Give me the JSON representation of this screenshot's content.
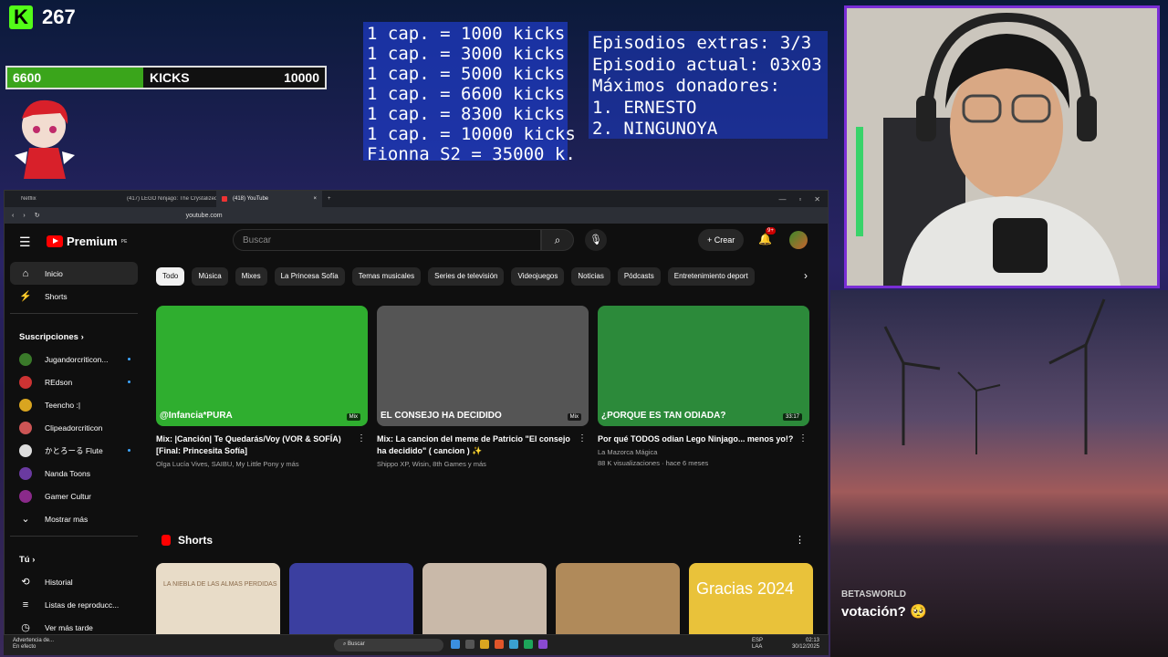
{
  "overlay": {
    "kick_count": "267",
    "goal": {
      "start": "6600",
      "label": "KICKS",
      "end": "10000",
      "progress": 0.66
    },
    "chapters": [
      "1 cap. = 1000 kicks",
      "1 cap. = 3000 kicks",
      "1 cap. = 5000 kicks",
      "1 cap. = 6600 kicks",
      "1 cap. = 8300 kicks",
      "1 cap. = 10000 kicks",
      "Fionna S2 = 35000 k."
    ],
    "extras": [
      "Episodios extras: 3/3",
      "Episodio actual: 03x03",
      "Máximos donadores:",
      "1. ERNESTO",
      "2. NINGUNOYA"
    ],
    "chat": {
      "user": "BETASWORLD",
      "message": "votación? 🥺"
    }
  },
  "browser": {
    "tabs": [
      {
        "label": "Netflix",
        "active": false
      },
      {
        "label": "(417) LEGO Ninjago: The Crystalized",
        "active": false
      },
      {
        "label": "(418) YouTube",
        "active": true
      }
    ],
    "url": "youtube.com"
  },
  "youtube": {
    "logo": "Premium",
    "logo_sup": "PE",
    "search_placeholder": "Buscar",
    "create_label": "Crear",
    "notif_badge": "9+",
    "sidebar": {
      "main": [
        {
          "label": "Inicio",
          "icon": "home-icon",
          "active": true
        },
        {
          "label": "Shorts",
          "icon": "shorts-icon",
          "active": false
        }
      ],
      "subs_title": "Suscripciones",
      "subs": [
        {
          "label": "Jugandorcriticon...",
          "color": "#3a7a2a"
        },
        {
          "label": "REdson",
          "color": "#c33"
        },
        {
          "label": "Teencho :|",
          "color": "#d9a520"
        },
        {
          "label": "Clipeadorcriticon",
          "color": "#c55"
        },
        {
          "label": "かとろーる Flute",
          "color": "#ddd"
        },
        {
          "label": "Nanda Toons",
          "color": "#6a3aa0"
        },
        {
          "label": "Gamer Cultur",
          "color": "#8a2a8a"
        }
      ],
      "show_more": "Mostrar más",
      "you_title": "Tú",
      "you": [
        {
          "label": "Historial",
          "icon": "history-icon"
        },
        {
          "label": "Listas de reproducc...",
          "icon": "playlist-icon"
        },
        {
          "label": "Ver más tarde",
          "icon": "clock-icon"
        }
      ]
    },
    "chips": [
      "Todo",
      "Música",
      "Mixes",
      "La Princesa Sofía",
      "Temas musicales",
      "Series de televisión",
      "Videojuegos",
      "Noticias",
      "Pódcasts",
      "Entretenimiento deport"
    ],
    "videos": [
      {
        "title": "Mix: |Canción| Te Quedarás/Voy (VOR & SOFÍA) [Final: Princesita Sofía]",
        "meta": "Olga Lucía Vives, SAIBU, My Little Pony y más",
        "tag": "Mix",
        "caption": "@Infancia*PURA",
        "bg": "#2fae2f"
      },
      {
        "title": "Mix: La cancion del meme de Patricio \"El consejo ha decidido\" ( cancion ) ✨",
        "meta": "Shippo XP, Wisin, 8th Games y más",
        "tag": "Mix",
        "caption": "EL CONSEJO HA DECIDIDO",
        "bg": "#555555"
      },
      {
        "title": "Por qué TODOS odian Lego Ninjago... menos yo!?",
        "meta": "La Mazorca Mágica",
        "meta2": "88 K visualizaciones · hace 6 meses",
        "tag": "33:17",
        "caption": "¿PORQUE ES TAN ODIADA?",
        "bg": "#2c8a3a"
      }
    ],
    "shorts_title": "Shorts",
    "shorts": [
      {
        "text": "LA NIEBLA DE LAS ALMAS PERDIDAS",
        "bg": "#e8dcc8"
      },
      {
        "text": "",
        "bg": "#3b3fa0"
      },
      {
        "text": "",
        "bg": "#c9b9a9"
      },
      {
        "text": "",
        "bg": "#b08a5a"
      },
      {
        "text": "Gracias 2024",
        "bg": "#e9c23a"
      }
    ]
  },
  "taskbar": {
    "warning": "Advertencia de...",
    "warning_sub": "En efecto",
    "search": "Buscar",
    "lang": "ESP",
    "lang_sub": "LAA",
    "time": "02:13",
    "date": "30/12/2025"
  }
}
